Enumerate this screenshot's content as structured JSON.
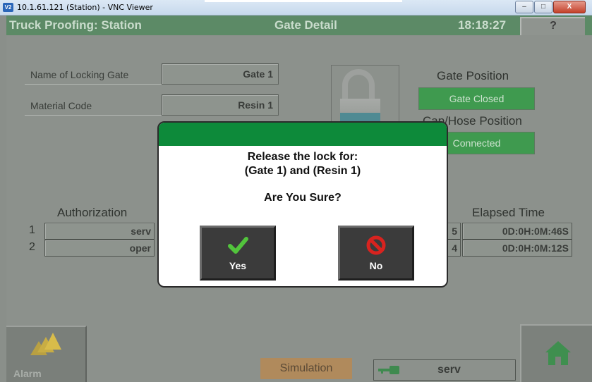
{
  "window": {
    "logo_text": "V2",
    "title": "10.1.61.121 (Station) - VNC Viewer",
    "min_label": "–",
    "max_label": "□",
    "close_label": "X"
  },
  "header": {
    "app_title": "Truck Proofing: Station",
    "page_title": "Gate Detail",
    "clock": "18:18:27",
    "help_label": "?"
  },
  "gate": {
    "name_label": "Name of Locking Gate",
    "name_value": "Gate 1",
    "material_label": "Material Code",
    "material_value": "Resin 1"
  },
  "position": {
    "gate_position_title": "Gate Position",
    "gate_status": "Gate Closed",
    "hose_position_title": "Cap/Hose Position",
    "hose_status": "Connected",
    "status_color": "#3f9a4f"
  },
  "authorization": {
    "title": "Authorization",
    "rows": [
      {
        "num": "1",
        "user": "serv"
      },
      {
        "num": "2",
        "user": "oper"
      }
    ]
  },
  "elapsed": {
    "title": "Elapsed Time",
    "rows": [
      {
        "idx": "5",
        "time": "0D:0H:0M:46S"
      },
      {
        "idx": "4",
        "time": "0D:0H:0M:12S"
      }
    ]
  },
  "bottom": {
    "alarm_label": "Alarm",
    "simulation_label": "Simulation",
    "current_user": "serv",
    "alarm_icon": "warning-triangles-icon",
    "home_icon": "home-icon",
    "key_icon": "key-icon"
  },
  "dialog": {
    "line1": "Release the lock for:",
    "line2": "(Gate 1) and (Resin 1)",
    "line3": "Are You Sure?",
    "yes_label": "Yes",
    "no_label": "No",
    "yes_icon": "checkmark-icon",
    "no_icon": "prohibited-icon",
    "header_color": "#0d8a3a"
  }
}
